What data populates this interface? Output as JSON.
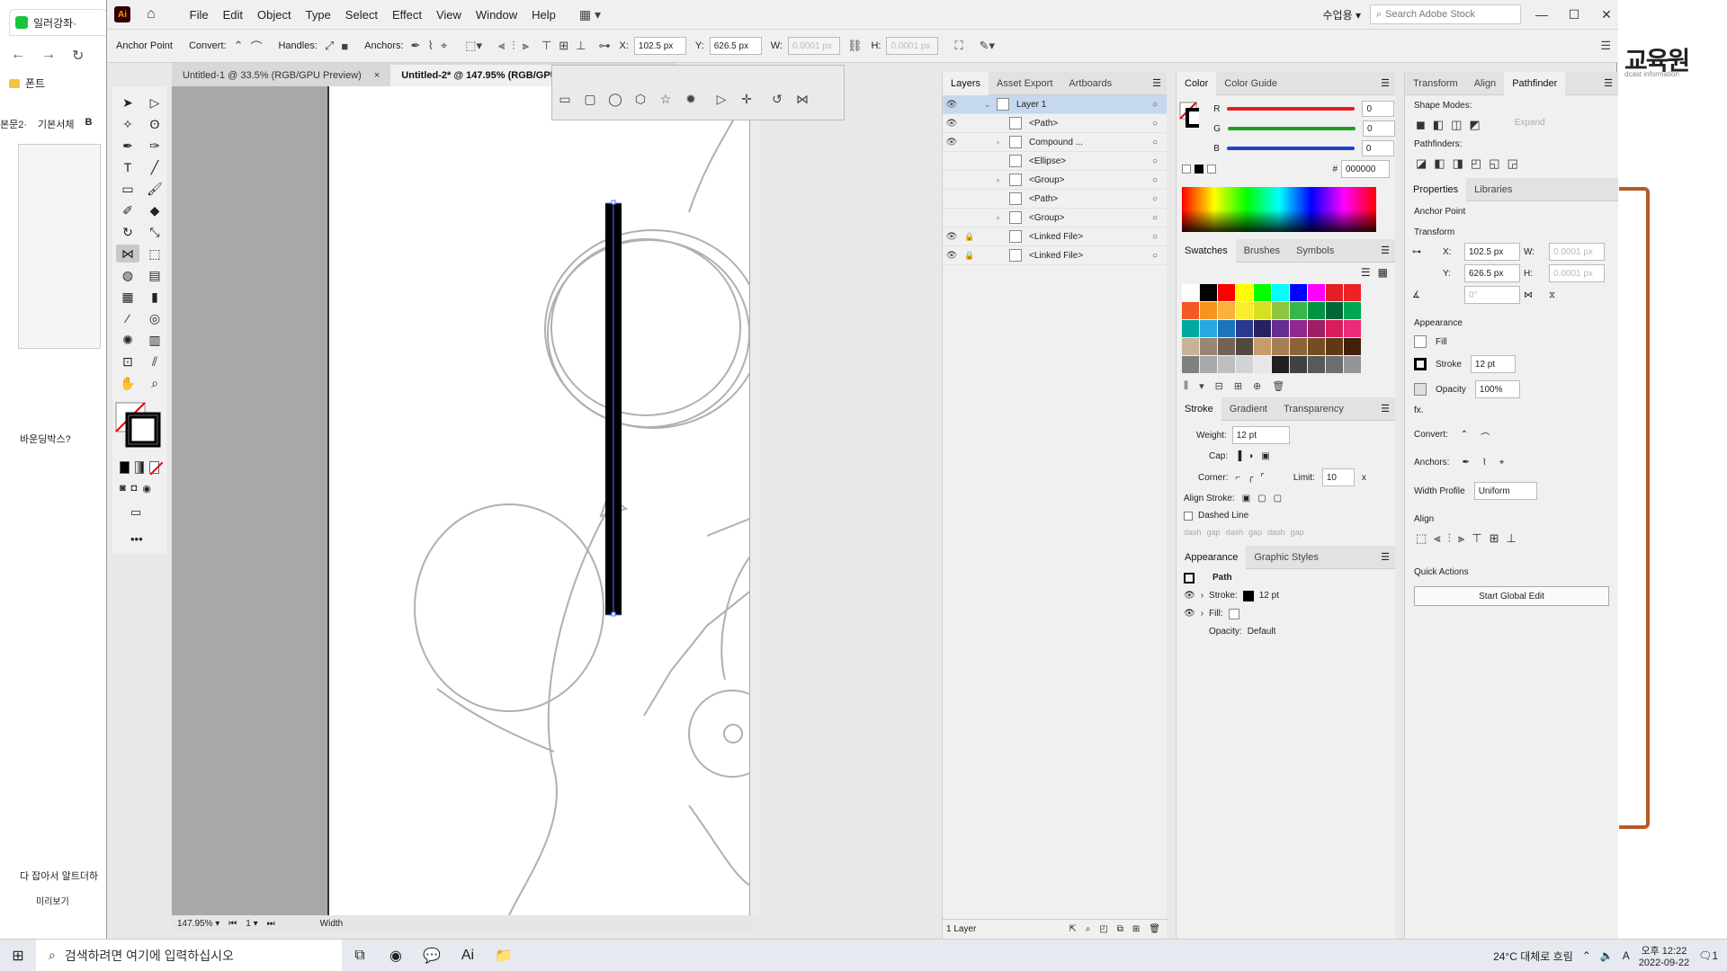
{
  "browser": {
    "tab_title": "일러강좌·",
    "bookmark": "폰트",
    "toolbar_labels": [
      "본문2·",
      "기본서체",
      "B"
    ],
    "question_text": "바운딩박스?",
    "bottom_text": "다 잡아서 알트더하",
    "preview_label": "미리보기",
    "right_logo": "교육원",
    "right_sub": "dcast information"
  },
  "menubar": {
    "app_icon": "Ai",
    "items": [
      "File",
      "Edit",
      "Object",
      "Type",
      "Select",
      "Effect",
      "View",
      "Window",
      "Help"
    ],
    "workspace": "수업용",
    "search_placeholder": "Search Adobe Stock"
  },
  "control_bar": {
    "tool_name": "Anchor Point",
    "convert_label": "Convert:",
    "handles_label": "Handles:",
    "anchors_label": "Anchors:",
    "x_label": "X:",
    "x_value": "102.5 px",
    "y_label": "Y:",
    "y_value": "626.5 px",
    "w_label": "W:",
    "w_value": "0.0001 px",
    "h_label": "H:",
    "h_value": "0.0001 px"
  },
  "tabs": [
    {
      "label": "Untitled-1 @ 33.5% (RGB/GPU Preview)",
      "close": "×"
    },
    {
      "label": "Untitled-2* @ 147.95% (RGB/GPU",
      "close": "×"
    }
  ],
  "status": {
    "zoom": "147.95%",
    "artboard": "1",
    "tool": "Width"
  },
  "layers_panel": {
    "tabs": [
      "Layers",
      "Asset Export",
      "Artboards"
    ],
    "rows": [
      {
        "name": "Layer 1",
        "eye": true,
        "lock": false,
        "expand": "open",
        "indent": 0
      },
      {
        "name": "<Path>",
        "eye": true,
        "lock": false,
        "expand": "",
        "indent": 1
      },
      {
        "name": "Compound ...",
        "eye": true,
        "lock": false,
        "expand": "closed",
        "indent": 1
      },
      {
        "name": "<Ellipse>",
        "eye": false,
        "lock": false,
        "expand": "",
        "indent": 1
      },
      {
        "name": "<Group>",
        "eye": false,
        "lock": false,
        "expand": "closed",
        "indent": 1
      },
      {
        "name": "<Path>",
        "eye": false,
        "lock": false,
        "expand": "",
        "indent": 1
      },
      {
        "name": "<Group>",
        "eye": false,
        "lock": false,
        "expand": "closed",
        "indent": 1
      },
      {
        "name": "<Linked File>",
        "eye": true,
        "lock": true,
        "expand": "",
        "indent": 1
      },
      {
        "name": "<Linked File>",
        "eye": true,
        "lock": true,
        "expand": "",
        "indent": 1
      }
    ],
    "footer": "1 Layer"
  },
  "color_panel": {
    "tabs": [
      "Color",
      "Color Guide"
    ],
    "sliders": [
      {
        "label": "R",
        "value": "0",
        "color": "#e02020"
      },
      {
        "label": "G",
        "value": "0",
        "color": "#20a020"
      },
      {
        "label": "B",
        "value": "0",
        "color": "#2040d0"
      }
    ],
    "hex_label": "#",
    "hex": "000000"
  },
  "swatches_panel": {
    "tabs": [
      "Swatches",
      "Brushes",
      "Symbols"
    ],
    "colors": [
      "#ffffff",
      "#000000",
      "#ff0000",
      "#ffff00",
      "#00ff00",
      "#00ffff",
      "#0000ff",
      "#ff00ff",
      "#e41e26",
      "#ec2326",
      "#f15a24",
      "#f7941d",
      "#fbb040",
      "#f9ed32",
      "#d7df23",
      "#8dc63f",
      "#39b54a",
      "#009444",
      "#006838",
      "#00a651",
      "#00a99d",
      "#27aae1",
      "#1c75bc",
      "#2b388f",
      "#262262",
      "#662d91",
      "#92278f",
      "#9e1f63",
      "#da1c5c",
      "#ee2a7b",
      "#c7b299",
      "#998675",
      "#736357",
      "#534741",
      "#c69c6d",
      "#a67c52",
      "#8c6239",
      "#754c24",
      "#603813",
      "#42210b",
      "#808080",
      "#a7a9ac",
      "#bcbec0",
      "#d1d3d4",
      "#e6e7e8",
      "#231f20",
      "#414042",
      "#58595b",
      "#6d6e71",
      "#939598"
    ]
  },
  "stroke_panel": {
    "tabs": [
      "Stroke",
      "Gradient",
      "Transparency"
    ],
    "weight_label": "Weight:",
    "weight": "12 pt",
    "cap_label": "Cap:",
    "corner_label": "Corner:",
    "limit_label": "Limit:",
    "limit": "10",
    "limit_unit": "x",
    "align_label": "Align Stroke:",
    "dashed_label": "Dashed Line",
    "dash_labels": [
      "dash",
      "gap",
      "dash",
      "gap",
      "dash",
      "gap"
    ]
  },
  "appearance_panel": {
    "tabs": [
      "Appearance",
      "Graphic Styles"
    ],
    "object": "Path",
    "stroke_label": "Stroke:",
    "stroke_value": "12 pt",
    "fill_label": "Fill:",
    "opacity_label": "Opacity:",
    "opacity_value": "Default"
  },
  "pathfinder_panel": {
    "tabs": [
      "Transform",
      "Align",
      "Pathfinder"
    ],
    "shape_modes": "Shape Modes:",
    "expand": "Expand",
    "pathfinders": "Pathfinders:"
  },
  "properties_panel": {
    "tabs": [
      "Properties",
      "Libraries"
    ],
    "selection": "Anchor Point",
    "transform": "Transform",
    "x_label": "X:",
    "x_value": "102.5 px",
    "y_label": "Y:",
    "y_value": "626.5 px",
    "w_label": "W:",
    "w_value": "0.0001 px",
    "h_label": "H:",
    "h_value": "0.0001 px",
    "angle_value": "0°",
    "appearance": "Appearance",
    "fill": "Fill",
    "stroke": "Stroke",
    "stroke_value": "12 pt",
    "opacity": "Opacity",
    "opacity_value": "100%",
    "fx": "fx.",
    "convert": "Convert:",
    "anchors": "Anchors:",
    "width_profile": "Width Profile",
    "width_profile_value": "Uniform",
    "align": "Align",
    "quick_actions": "Quick Actions",
    "global_edit": "Start Global Edit"
  },
  "taskbar": {
    "search": "검색하려면 여기에 입력하십시오",
    "weather": "24°C 대체로 흐림",
    "ime": "A",
    "time": "오후 12:22",
    "date": "2022-09-22",
    "notification": "1"
  }
}
